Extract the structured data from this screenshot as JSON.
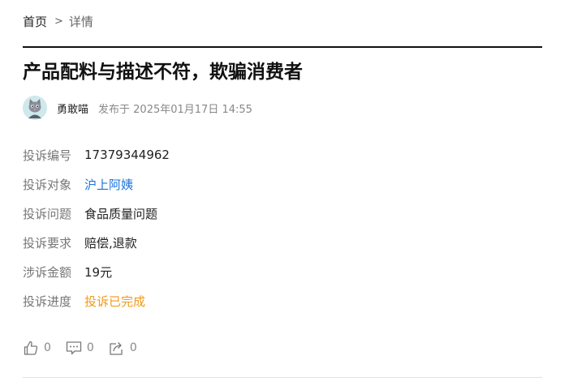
{
  "breadcrumb": {
    "home": "首页",
    "separator": ">",
    "current": "详情"
  },
  "complaint": {
    "title": "产品配料与描述不符，欺骗消费者",
    "author": "勇敢喵",
    "published": "发布于 2025年01月17日 14:55",
    "fields": [
      {
        "label": "投诉编号",
        "value": "17379344962"
      },
      {
        "label": "投诉对象",
        "value": "沪上阿姨"
      },
      {
        "label": "投诉问题",
        "value": "食品质量问题"
      },
      {
        "label": "投诉要求",
        "value": "赔偿,退款"
      },
      {
        "label": "涉诉金额",
        "value": "19元"
      },
      {
        "label": "投诉进度",
        "value": "投诉已完成"
      }
    ]
  },
  "actions": {
    "like_count": "0",
    "comment_count": "0",
    "share_count": "0"
  },
  "colors": {
    "link": "#1a73d9",
    "status": "#f09a1a",
    "label": "#777777"
  }
}
